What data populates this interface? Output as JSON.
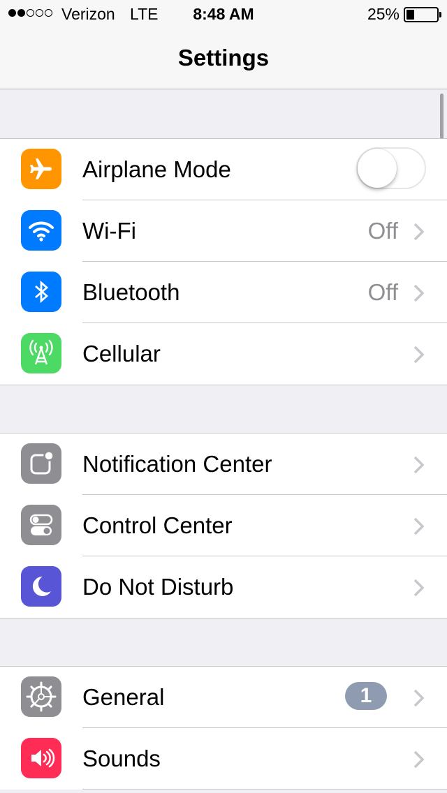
{
  "status_bar": {
    "signal_filled": 2,
    "signal_total": 5,
    "carrier": "Verizon",
    "network": "LTE",
    "time": "8:48 AM",
    "battery_percent_label": "25%",
    "battery_level": 0.25
  },
  "nav": {
    "title": "Settings"
  },
  "groups": [
    {
      "rows": [
        {
          "label": "Airplane Mode",
          "icon": "airplane-icon",
          "icon_color": "#ff9500",
          "toggle_on": false
        },
        {
          "label": "Wi-Fi",
          "icon": "wifi-icon",
          "icon_color": "#007aff",
          "value": "Off"
        },
        {
          "label": "Bluetooth",
          "icon": "bluetooth-icon",
          "icon_color": "#007aff",
          "value": "Off"
        },
        {
          "label": "Cellular",
          "icon": "cellular-icon",
          "icon_color": "#4cd964"
        }
      ]
    },
    {
      "rows": [
        {
          "label": "Notification Center",
          "icon": "notification-center-icon",
          "icon_color": "#8e8e93"
        },
        {
          "label": "Control Center",
          "icon": "control-center-icon",
          "icon_color": "#8e8e93"
        },
        {
          "label": "Do Not Disturb",
          "icon": "moon-icon",
          "icon_color": "#5856d6"
        }
      ]
    },
    {
      "rows": [
        {
          "label": "General",
          "icon": "gear-icon",
          "icon_color": "#8e8e93",
          "badge": "1"
        },
        {
          "label": "Sounds",
          "icon": "speaker-icon",
          "icon_color": "#ff2d55"
        }
      ]
    }
  ]
}
